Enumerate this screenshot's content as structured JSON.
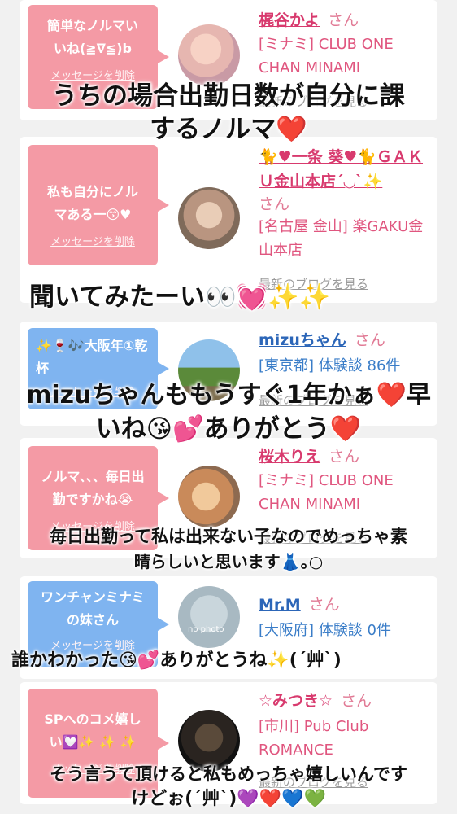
{
  "cards": [
    {
      "bubble_text": "簡単なノルマいいね(≧∇≦)b",
      "delete_label": "メッセージを削除",
      "name": "梶谷かよ",
      "honorific": "さん",
      "info": "[ミナミ] CLUB ONE CHAN MINAMI",
      "blog_link": "最新のブログを見る",
      "avatar_icon": "profile-photo"
    },
    {
      "bubble_text": "私も自分にノルマある一😙♥",
      "delete_label": "メッセージを削除",
      "name": "🐈♥一条 葵♥🐈ＧＡＫＵ金山本店´◡`✨",
      "honorific": "さん",
      "info": "[名古屋 金山] 楽GAKU金山本店",
      "blog_link": "最新のブログを見る",
      "avatar_icon": "profile-photo"
    },
    {
      "bubble_text": "✨🍷🎶大阪年①乾杯",
      "delete_label": "メッセージを削除",
      "name": "mizuちゃん",
      "honorific": "さん",
      "info": "[東京都] 体験談 86件",
      "blog_link": "最新のブログを見る",
      "avatar_icon": "landscape-photo"
    },
    {
      "bubble_text": "ノルマ、、、毎日出勤ですかね😭",
      "delete_label": "メッセージを削除",
      "name": "桜木りえ",
      "honorific": "さん",
      "info": "[ミナミ] CLUB ONE CHAN MINAMI",
      "blog_link": "最新のブログを見る",
      "avatar_icon": "profile-photo"
    },
    {
      "bubble_text": "ワンチャンミナミの妹さん",
      "delete_label": "メッセージを削除",
      "name": "Mr.M",
      "honorific": "さん",
      "info": "[大阪府] 体験談 0件",
      "blog_link": "",
      "avatar_icon": "no-photo",
      "avatar_text": "no photo"
    },
    {
      "bubble_text": "SPへのコメ嬉しい💟✨ ✨ ✨",
      "delete_label": "メッセージを削除",
      "name": "☆みつき☆",
      "honorific": "さん",
      "info": "[市川] Pub Club ROMANCE",
      "blog_link": "最新のブログを見る",
      "avatar_icon": "profile-photo"
    }
  ],
  "captions": [
    "うちの場合出勤日数が自分に課",
    "するノルマ❤️",
    "聞いてみたーい👀💓✨✨",
    "mizuちゃんももうすぐ1年かぁ❤️早",
    "いね😘💕ありがとう❤️",
    "毎日出勤って私は出来ない子なのでめっちゃ素",
    "晴らしいと思います👗｡○",
    "誰かわかった😘💕ありがとうね✨(´艸`)",
    "そう言うて頂けると私もめっちゃ嬉しいんです",
    "けどぉ(´艸`)💜❤️💙💚"
  ],
  "colors": {
    "bubble_pink": "#f49aa5",
    "bubble_blue": "#7fb4f0",
    "name_pink": "#d83a6e",
    "name_blue": "#2c66b8"
  }
}
